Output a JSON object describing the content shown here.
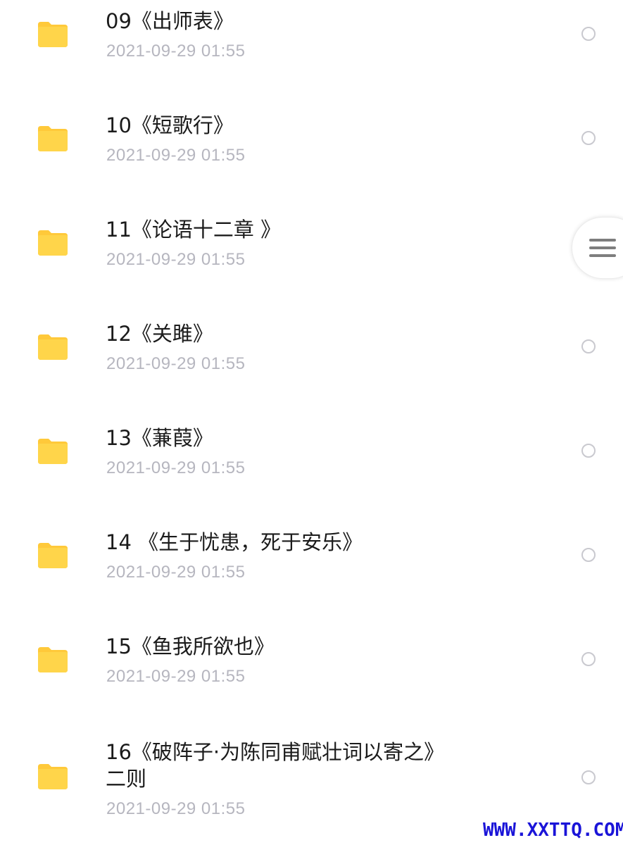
{
  "files": [
    {
      "name": "09《出师表》",
      "date": "2021-09-29 01:55"
    },
    {
      "name": "10《短歌行》",
      "date": "2021-09-29 01:55"
    },
    {
      "name": "11《论语十二章 》",
      "date": "2021-09-29 01:55"
    },
    {
      "name": "12《关雎》",
      "date": "2021-09-29 01:55"
    },
    {
      "name": "13《蒹葭》",
      "date": "2021-09-29 01:55"
    },
    {
      "name": "14 《生于忧患，死于安乐》",
      "date": "2021-09-29 01:55"
    },
    {
      "name": "15《鱼我所欲也》",
      "date": "2021-09-29 01:55"
    },
    {
      "name": "16《破阵子·为陈同甫赋壮词以寄之》\n二则",
      "date": "2021-09-29 01:55"
    }
  ],
  "icons": {
    "folder": "folder-icon",
    "select": "radio-circle-icon",
    "side_menu": "hamburger-menu-icon"
  },
  "colors": {
    "folder": "#FFD54A",
    "folder_tab": "#FFC93A",
    "date_text": "#B6B6BF",
    "name_text": "#1B1B1B",
    "watermark": "#1A14D8"
  },
  "watermark": "WWW.XXTTQ.COM"
}
